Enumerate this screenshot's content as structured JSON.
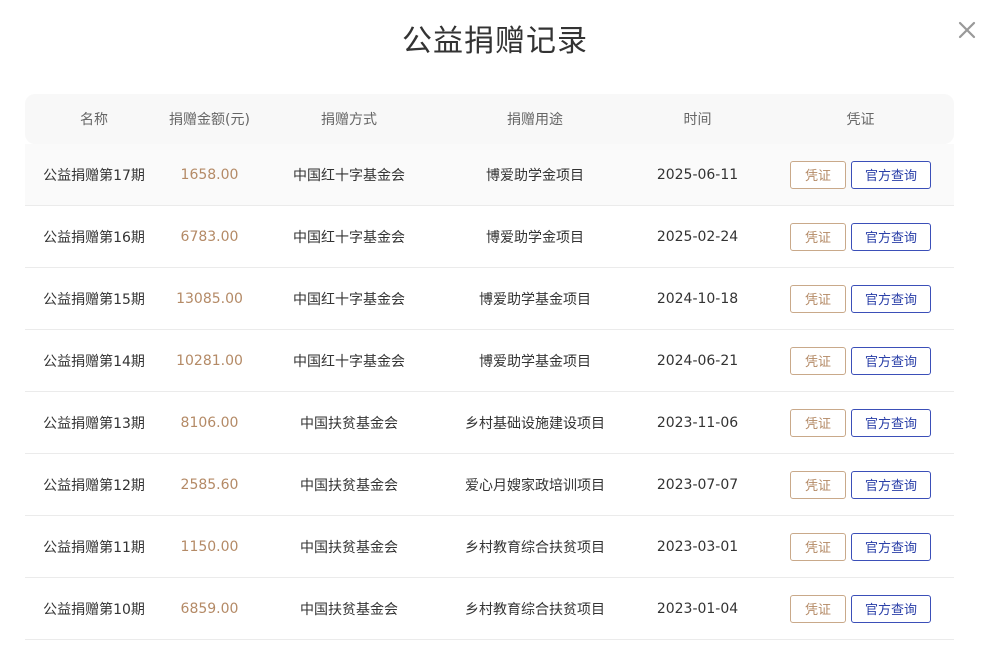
{
  "dialog": {
    "title": "公益捐赠记录",
    "close_icon": "close-icon"
  },
  "colors": {
    "amount": "#b48a66",
    "cert_button": "#b48a66",
    "official_button": "#2a3fa8",
    "header_bg": "#f8f8f8"
  },
  "table": {
    "headers": [
      "名称",
      "捐赠金额(元)",
      "捐赠方式",
      "捐赠用途",
      "时间",
      "凭证"
    ],
    "rows": [
      {
        "name": "公益捐赠第17期",
        "amount": "1658.00",
        "method": "中国红十字基金会",
        "purpose": "博爱助学金项目",
        "time": "2025-06-11",
        "cert_label": "凭证",
        "official_label": "官方查询"
      },
      {
        "name": "公益捐赠第16期",
        "amount": "6783.00",
        "method": "中国红十字基金会",
        "purpose": "博爱助学金项目",
        "time": "2025-02-24",
        "cert_label": "凭证",
        "official_label": "官方查询"
      },
      {
        "name": "公益捐赠第15期",
        "amount": "13085.00",
        "method": "中国红十字基金会",
        "purpose": "博爱助学基金项目",
        "time": "2024-10-18",
        "cert_label": "凭证",
        "official_label": "官方查询"
      },
      {
        "name": "公益捐赠第14期",
        "amount": "10281.00",
        "method": "中国红十字基金会",
        "purpose": "博爱助学基金项目",
        "time": "2024-06-21",
        "cert_label": "凭证",
        "official_label": "官方查询"
      },
      {
        "name": "公益捐赠第13期",
        "amount": "8106.00",
        "method": "中国扶贫基金会",
        "purpose": "乡村基础设施建设项目",
        "time": "2023-11-06",
        "cert_label": "凭证",
        "official_label": "官方查询"
      },
      {
        "name": "公益捐赠第12期",
        "amount": "2585.60",
        "method": "中国扶贫基金会",
        "purpose": "爱心月嫂家政培训项目",
        "time": "2023-07-07",
        "cert_label": "凭证",
        "official_label": "官方查询"
      },
      {
        "name": "公益捐赠第11期",
        "amount": "1150.00",
        "method": "中国扶贫基金会",
        "purpose": "乡村教育综合扶贫项目",
        "time": "2023-03-01",
        "cert_label": "凭证",
        "official_label": "官方查询"
      },
      {
        "name": "公益捐赠第10期",
        "amount": "6859.00",
        "method": "中国扶贫基金会",
        "purpose": "乡村教育综合扶贫项目",
        "time": "2023-01-04",
        "cert_label": "凭证",
        "official_label": "官方查询"
      }
    ]
  }
}
